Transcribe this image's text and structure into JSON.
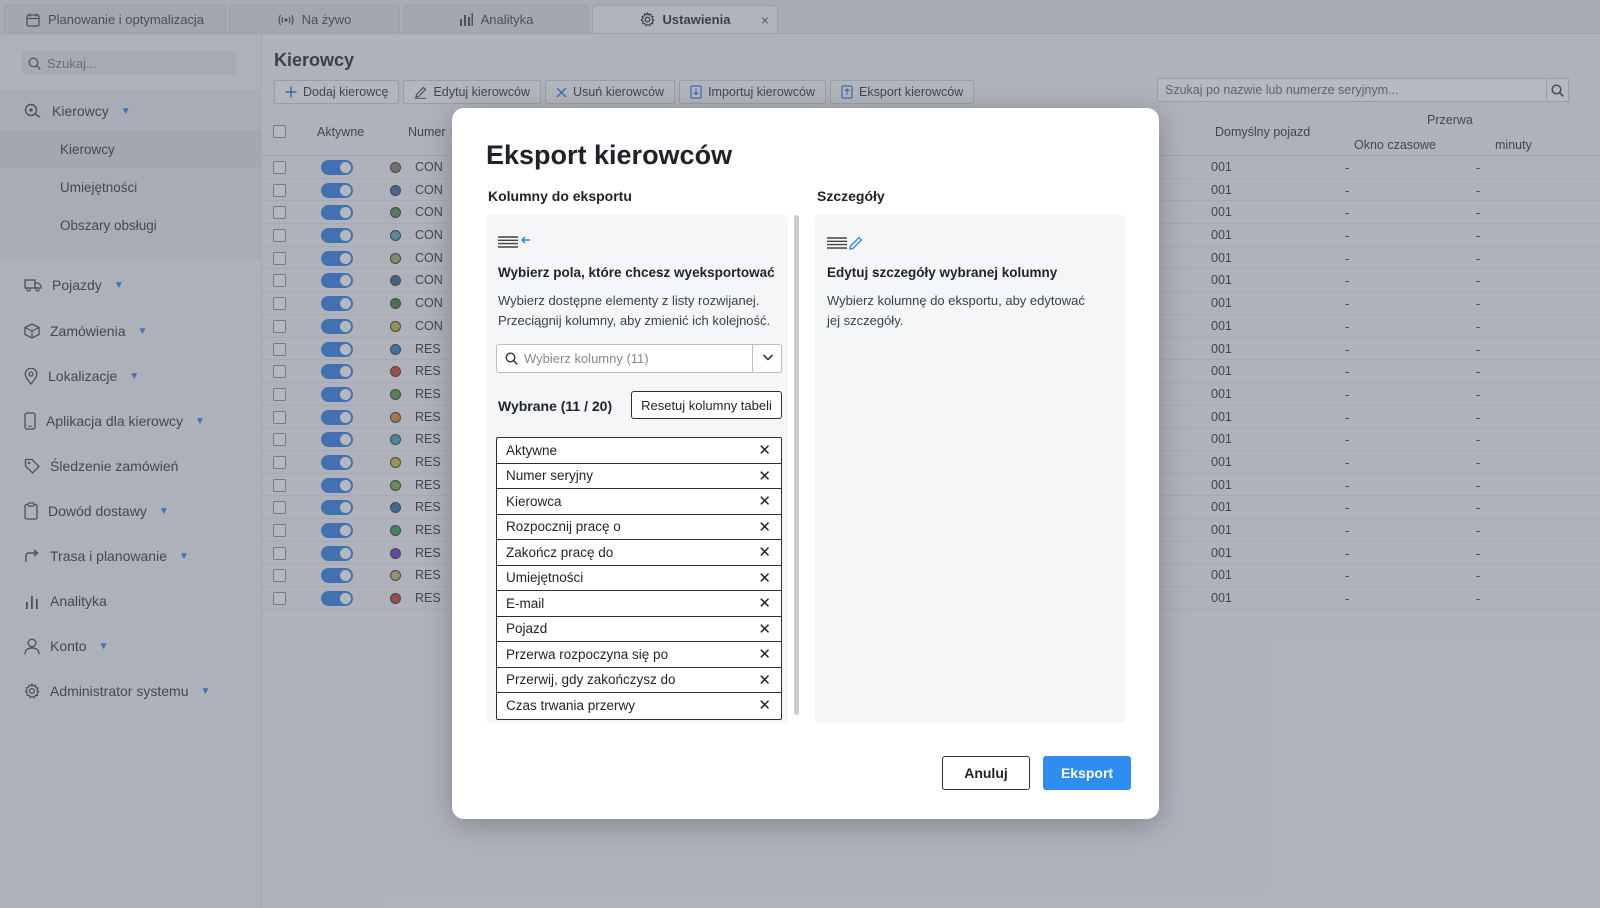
{
  "tabs": [
    {
      "label": "Planowanie i optymalizacja",
      "icon": "calendar-icon"
    },
    {
      "label": "Na żywo",
      "icon": "broadcast-icon"
    },
    {
      "label": "Analityka",
      "icon": "bar-chart-icon"
    },
    {
      "label": "Ustawienia",
      "icon": "gear-icon"
    }
  ],
  "tab_close": "×",
  "sidebar": {
    "search_placeholder": "Szukaj...",
    "items": [
      {
        "label": "Kierowcy",
        "icon": "drivers-icon",
        "subitems": [
          "Kierowcy",
          "Umiejętności",
          "Obszary obsługi"
        ]
      },
      {
        "label": "Pojazdy",
        "icon": "truck-icon"
      },
      {
        "label": "Zamówienia",
        "icon": "box-icon"
      },
      {
        "label": "Lokalizacje",
        "icon": "pin-icon"
      },
      {
        "label": "Aplikacja dla kierowcy",
        "icon": "phone-icon"
      },
      {
        "label": "Śledzenie zamówień",
        "icon": "tag-icon"
      },
      {
        "label": "Dowód dostawy",
        "icon": "clipboard-icon"
      },
      {
        "label": "Trasa i planowanie",
        "icon": "route-icon"
      },
      {
        "label": "Analityka",
        "icon": "bar-chart-icon"
      },
      {
        "label": "Konto",
        "icon": "user-icon"
      },
      {
        "label": "Administrator systemu",
        "icon": "gear-icon"
      }
    ]
  },
  "main": {
    "title": "Kierowcy",
    "toolbar": [
      {
        "label": "Dodaj kierowcę",
        "icon": "plus-icon"
      },
      {
        "label": "Edytuj kierowców",
        "icon": "pencil-icon"
      },
      {
        "label": "Usuń kierowców",
        "icon": "close-icon"
      },
      {
        "label": "Importuj kierowców",
        "icon": "import-icon"
      },
      {
        "label": "Eksport kierowców",
        "icon": "export-icon"
      }
    ],
    "search_placeholder": "Szukaj po nazwie lub numerze seryjnym...",
    "table": {
      "headers": {
        "active": "Aktywne",
        "serial": "Numer",
        "vehicle": "Domyślny pojazd",
        "break": "Przerwa",
        "window": "Okno czasowe",
        "minutes": "minuty"
      },
      "rows": [
        {
          "color": "#8a7d6a",
          "serial": "CON",
          "vehicle": "001",
          "window": "-",
          "minutes": "-"
        },
        {
          "color": "#3b6aa8",
          "serial": "CON",
          "vehicle": "001",
          "window": "-",
          "minutes": "-"
        },
        {
          "color": "#5b8f4d",
          "serial": "CON",
          "vehicle": "001",
          "window": "-",
          "minutes": "-"
        },
        {
          "color": "#5aa9b3",
          "serial": "CON",
          "vehicle": "001",
          "window": "-",
          "minutes": "-"
        },
        {
          "color": "#a9a66a",
          "serial": "CON",
          "vehicle": "001",
          "window": "-",
          "minutes": "-"
        },
        {
          "color": "#3a5f8f",
          "serial": "CON",
          "vehicle": "001",
          "window": "-",
          "minutes": "-"
        },
        {
          "color": "#3f7f3a",
          "serial": "CON",
          "vehicle": "001",
          "window": "-",
          "minutes": "-"
        },
        {
          "color": "#c4b43a",
          "serial": "CON",
          "vehicle": "001",
          "window": "-",
          "minutes": "-"
        },
        {
          "color": "#2f7fd0",
          "serial": "RES",
          "vehicle": "001",
          "window": "-",
          "minutes": "-"
        },
        {
          "color": "#d0432f",
          "serial": "RES",
          "vehicle": "001",
          "window": "-",
          "minutes": "-"
        },
        {
          "color": "#4f9f3a",
          "serial": "RES",
          "vehicle": "001",
          "window": "-",
          "minutes": "-"
        },
        {
          "color": "#e08a2f",
          "serial": "RES",
          "vehicle": "001",
          "window": "-",
          "minutes": "-"
        },
        {
          "color": "#3aa9b8",
          "serial": "RES",
          "vehicle": "001",
          "window": "-",
          "minutes": "-"
        },
        {
          "color": "#c8c02f",
          "serial": "RES",
          "vehicle": "001",
          "window": "-",
          "minutes": "-"
        },
        {
          "color": "#7aaf3a",
          "serial": "RES",
          "vehicle": "001",
          "window": "-",
          "minutes": "-"
        },
        {
          "color": "#2f6fb0",
          "serial": "RES",
          "vehicle": "001",
          "window": "-",
          "minutes": "-"
        },
        {
          "color": "#2f9f5a",
          "serial": "RES",
          "vehicle": "001",
          "window": "-",
          "minutes": "-"
        },
        {
          "color": "#6a3ad0",
          "serial": "RES",
          "vehicle": "001",
          "window": "-",
          "minutes": "-"
        },
        {
          "color": "#c8b46a",
          "serial": "RES",
          "vehicle": "001",
          "window": "-",
          "minutes": "-"
        },
        {
          "color": "#c0402f",
          "serial": "RES",
          "vehicle": "001",
          "window": "-",
          "minutes": "-"
        }
      ]
    }
  },
  "modal": {
    "title": "Eksport kierowców",
    "left_heading": "Kolumny do eksportu",
    "right_heading": "Szczegóły",
    "left_panel": {
      "heading": "Wybierz pola, które chcesz wyeksportować",
      "description": "Wybierz dostępne elementy z listy rozwijanej. Przeciągnij kolumny, aby zmienić ich kolejność.",
      "select_placeholder": "Wybierz kolumny (11)",
      "chosen_label": "Wybrane (11 / 20)",
      "reset_label": "Resetuj kolumny tabeli",
      "chosen": [
        "Aktywne",
        "Numer seryjny",
        "Kierowca",
        "Rozpocznij pracę o",
        "Zakończ pracę do",
        "Umiejętności",
        "E-mail",
        "Pojazd",
        "Przerwa rozpoczyna się po",
        "Przerwij, gdy zakończysz do",
        "Czas trwania przerwy"
      ],
      "remove_glyph": "✕"
    },
    "right_panel": {
      "heading": "Edytuj szczegóły wybranej kolumny",
      "description": "Wybierz kolumnę do eksportu, aby edytować jej szczegóły."
    },
    "cancel_label": "Anuluj",
    "export_label": "Eksport"
  },
  "colors": {
    "accent": "#2f8cf0",
    "toggle": "#2f7fe8"
  }
}
